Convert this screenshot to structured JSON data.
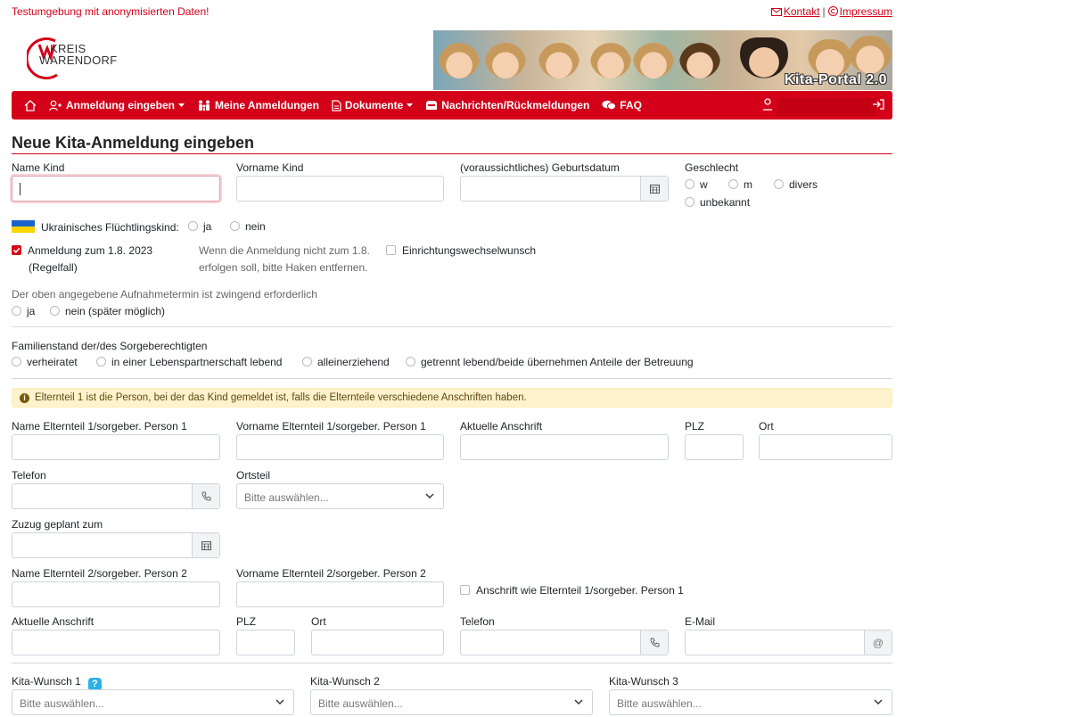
{
  "header": {
    "test_notice": "Testumgebung mit anonymisierten Daten!",
    "contact_link": "Kontakt",
    "separator": "|",
    "imprint_link": "Impressum",
    "logo_line1": "KREIS",
    "logo_line2": "WARENDORF",
    "banner_title": "Kita-Portal 2.0"
  },
  "nav": {
    "items": [
      {
        "label": "Anmeldung eingeben",
        "icon": "user-plus-icon",
        "dropdown": true
      },
      {
        "label": "Meine Anmeldungen",
        "icon": "family-icon",
        "dropdown": false
      },
      {
        "label": "Dokumente",
        "icon": "document-icon",
        "dropdown": true
      },
      {
        "label": "Nachrichten/Rückmeldungen",
        "icon": "inbox-icon",
        "dropdown": false
      },
      {
        "label": "FAQ",
        "icon": "chat-icon",
        "dropdown": false
      }
    ],
    "brand_color": "#d4001a"
  },
  "form": {
    "title": "Neue Kita-Anmeldung eingeben",
    "child": {
      "last_name_label": "Name Kind",
      "first_name_label": "Vorname Kind",
      "birthdate_label": "(voraussichtliches) Geburtsdatum",
      "gender_label": "Geschlecht",
      "gender_options": [
        "w",
        "m",
        "divers",
        "unbekannt"
      ]
    },
    "refugee": {
      "label": "Ukrainisches Flüchtlingskind:",
      "yes": "ja",
      "no": "nein"
    },
    "registration": {
      "checkbox_label_1": "Anmeldung zum 1.8. 2023",
      "checkbox_label_2": "(Regelfall)",
      "hint_1": "Wenn die Anmeldung nicht zum 1.8.",
      "hint_2": "erfolgen soll, bitte Haken entfernen.",
      "change_wish_label": "Einrichtungswechselwunsch"
    },
    "admission": {
      "label": "Der oben angegebene Aufnahmetermin ist zwingend erforderlich",
      "yes": "ja",
      "no": "nein (später möglich)"
    },
    "family": {
      "label": "Familienstand der/des Sorgeberechtigten",
      "options": [
        "verheiratet",
        "in einer Lebenspartnerschaft lebend",
        "alleinerziehend",
        "getrennt lebend/beide übernehmen Anteile der Betreuung"
      ]
    },
    "info_text": "Elternteil 1 ist die Person, bei der das Kind gemeldet ist, falls die Elternteile verschiedene Anschriften haben.",
    "parent1": {
      "last_name_label": "Name Elternteil 1/sorgeber. Person 1",
      "first_name_label": "Vorname Elternteil 1/sorgeber. Person 1",
      "address_label": "Aktuelle Anschrift",
      "zip_label": "PLZ",
      "city_label": "Ort",
      "phone_label": "Telefon",
      "district_label": "Ortsteil",
      "district_placeholder": "Bitte auswählen...",
      "move_label": "Zuzug geplant zum"
    },
    "parent2": {
      "last_name_label": "Name Elternteil 2/sorgeber. Person 2",
      "first_name_label": "Vorname Elternteil 2/sorgeber. Person 2",
      "same_address_label": "Anschrift wie Elternteil 1/sorgeber. Person 1",
      "address_label": "Aktuelle Anschrift",
      "zip_label": "PLZ",
      "city_label": "Ort",
      "phone_label": "Telefon",
      "email_label": "E-Mail"
    },
    "kita": {
      "wish1_label": "Kita-Wunsch 1",
      "wish2_label": "Kita-Wunsch 2",
      "wish3_label": "Kita-Wunsch 3",
      "help": "?",
      "placeholder": "Bitte auswählen..."
    }
  }
}
